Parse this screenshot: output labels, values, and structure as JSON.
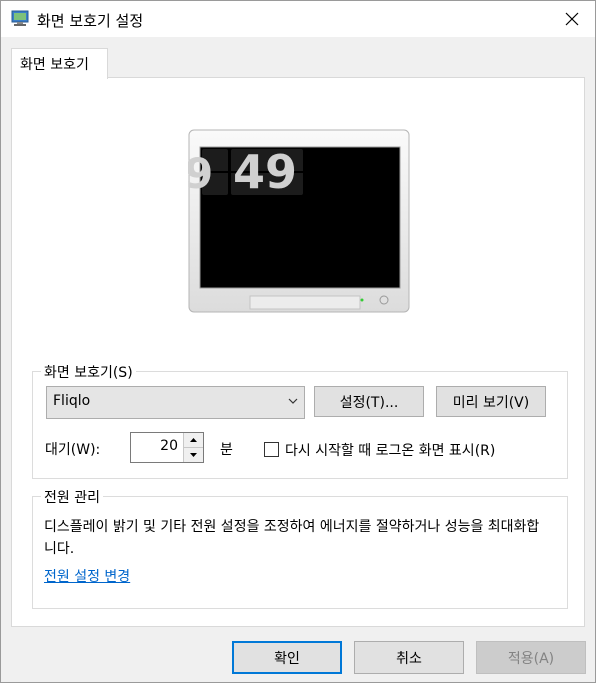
{
  "window": {
    "title": "화면 보호기 설정"
  },
  "tab": {
    "label": "화면 보호기"
  },
  "preview": {
    "clock_digits": "49",
    "clock_partial_digit": "9"
  },
  "screensaver_group": {
    "legend": "화면 보호기(S)",
    "selected": "Fliqlo",
    "settings_button": "설정(T)...",
    "preview_button": "미리 보기(V)",
    "wait_label": "대기(W):",
    "wait_value": "20",
    "wait_unit": "분",
    "resume_checkbox_label": "다시 시작할 때 로그온 화면 표시(R)",
    "resume_checked": false
  },
  "power_group": {
    "legend": "전원 관리",
    "description": "디스플레이 밝기 및 기타 전원 설정을 조정하여 에너지를 절약하거나 성능을 최대화합니다.",
    "link": "전원 설정 변경"
  },
  "buttons": {
    "ok": "확인",
    "cancel": "취소",
    "apply": "적용(A)"
  }
}
